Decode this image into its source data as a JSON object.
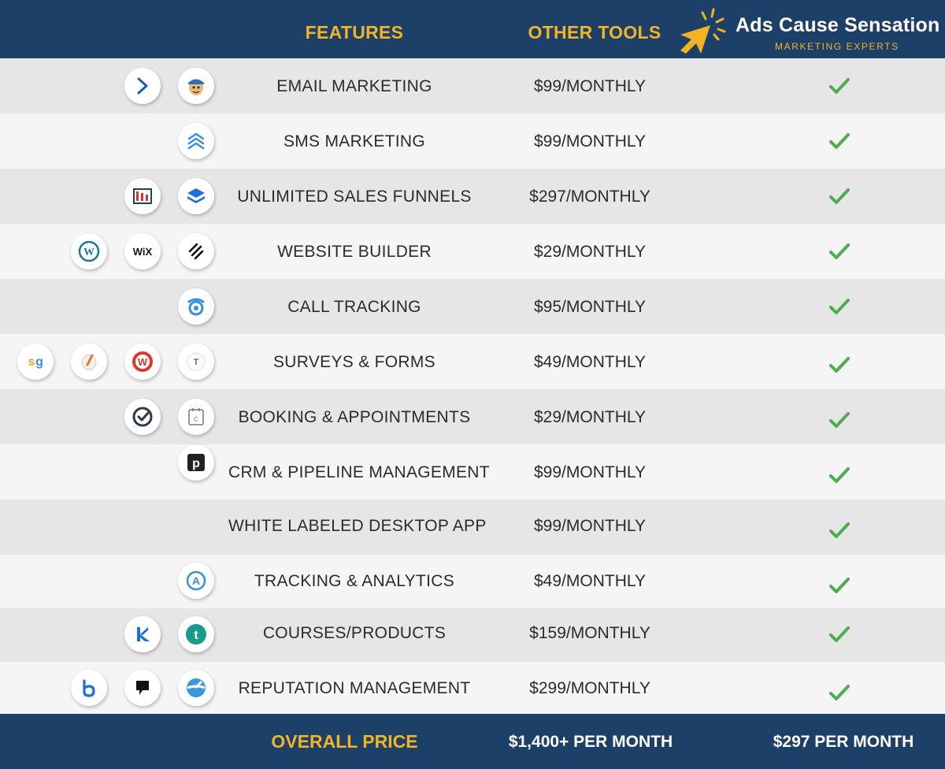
{
  "header": {
    "features_label": "FEATURES",
    "other_tools_label": "OTHER TOOLS",
    "brand_name": "Ads Cause Sensation",
    "brand_tagline": "MARKETING EXPERTS"
  },
  "colors": {
    "header_bg": "#1d4069",
    "accent_orange": "#f5b324",
    "check_green": "#4cae4c",
    "row_dark": "#e6e6e6",
    "row_light": "#f5f5f5"
  },
  "rows": [
    {
      "feature": "EMAIL MARKETING",
      "price": "$99/MONTHLY",
      "logos": [
        "activecampaign-icon",
        "mailchimp-icon"
      ]
    },
    {
      "feature": "SMS MARKETING",
      "price": "$99/MONTHLY",
      "logos": [
        "sms-stack-icon"
      ]
    },
    {
      "feature": "UNLIMITED SALES FUNNELS",
      "price": "$297/MONTHLY",
      "logos": [
        "clickfunnels-icon",
        "leadpages-icon"
      ]
    },
    {
      "feature": "WEBSITE BUILDER",
      "price": "$29/MONTHLY",
      "logos": [
        "wordpress-icon",
        "wix-icon",
        "squarespace-icon"
      ]
    },
    {
      "feature": "CALL TRACKING",
      "price": "$95/MONTHLY",
      "logos": [
        "calltracking-icon"
      ]
    },
    {
      "feature": "SURVEYS & FORMS",
      "price": "$49/MONTHLY",
      "logos": [
        "surveygizmo-icon",
        "jotform-icon",
        "wufoo-icon",
        "typeform-icon"
      ]
    },
    {
      "feature": "BOOKING & APPOINTMENTS",
      "price": "$29/MONTHLY",
      "logos": [
        "acuity-icon",
        "calendly-icon"
      ]
    },
    {
      "feature": "CRM & PIPELINE MANAGEMENT",
      "price": "$99/MONTHLY",
      "logos": [
        "pipedrive-icon"
      ]
    },
    {
      "feature": "WHITE LABELED DESKTOP APP",
      "price": "$99/MONTHLY",
      "logos": []
    },
    {
      "feature": "TRACKING & ANALYTICS",
      "price": "$49/MONTHLY",
      "logos": [
        "analytics-icon"
      ]
    },
    {
      "feature": "COURSES/PRODUCTS",
      "price": "$159/MONTHLY",
      "logos": [
        "kajabi-icon",
        "teachable-icon"
      ]
    },
    {
      "feature": "REPUTATION MANAGEMENT",
      "price": "$299/MONTHLY",
      "logos": [
        "birdeye-icon",
        "podium-icon",
        "reputation-icon"
      ]
    }
  ],
  "footer": {
    "label": "OVERALL PRICE",
    "other_tools_total": "$1,400+ PER MONTH",
    "our_price": "$297 PER MONTH"
  }
}
